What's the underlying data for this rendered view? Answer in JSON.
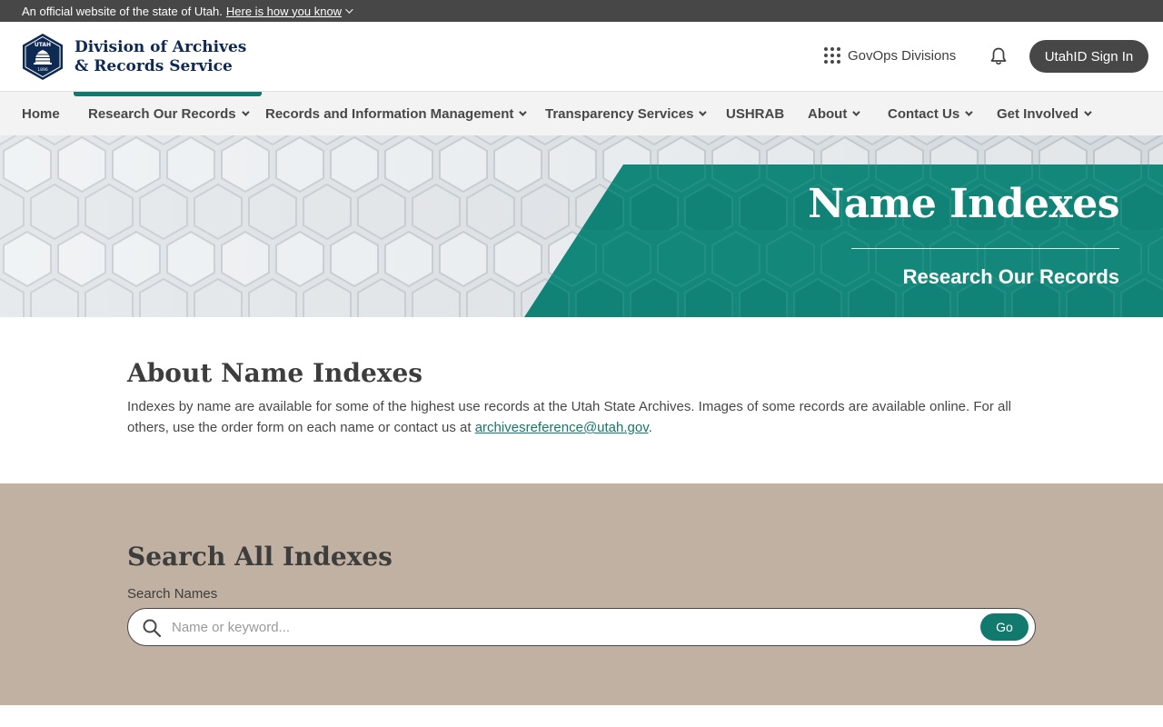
{
  "official_banner": {
    "text": "An official website of the state of Utah.",
    "link": "Here is how you know"
  },
  "header": {
    "title_line1": "Division of Archives",
    "title_line2": "& Records Service",
    "logo_text": "UTAH",
    "logo_year": "1896",
    "govops_label": "GovOps Divisions",
    "signin_label": "UtahID Sign In"
  },
  "nav": {
    "items": [
      {
        "label": "Home"
      },
      {
        "label": "Research Our Records"
      },
      {
        "label": "Records and Information Management"
      },
      {
        "label": "Transparency Services"
      },
      {
        "label": "USHRAB"
      },
      {
        "label": "About"
      },
      {
        "label": "Contact Us"
      },
      {
        "label": "Get Involved"
      }
    ]
  },
  "hero": {
    "title": "Name Indexes",
    "subtitle": "Research Our Records"
  },
  "about": {
    "heading": "About Name Indexes",
    "body": "Indexes by name are available for some of the highest use records at the Utah State Archives. Images of some records are available online. For all others, use the order form on each name or contact us at ",
    "email": "archivesreference@utah.gov",
    "end": "."
  },
  "search": {
    "heading": "Search All Indexes",
    "label": "Search Names",
    "placeholder": "Name or keyword...",
    "button": "Go"
  },
  "colors": {
    "teal": "#12796e",
    "navy": "#0e2a52",
    "tan": "#c1b1a2",
    "dark_gray": "#474747"
  }
}
